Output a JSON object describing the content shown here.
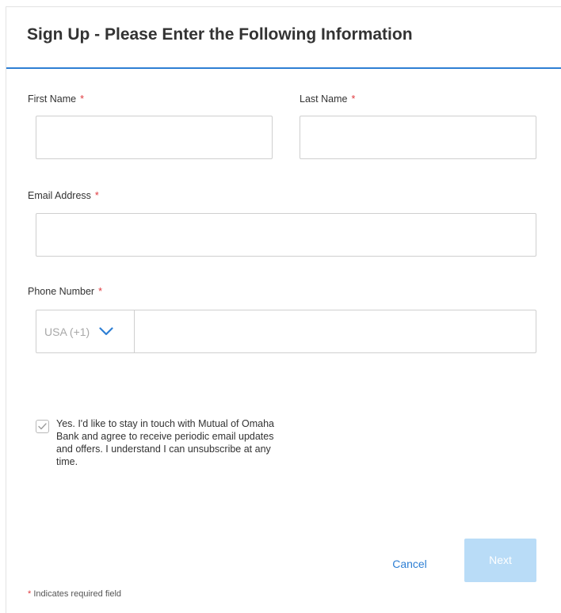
{
  "form": {
    "title": "Sign Up - Please Enter the Following Information",
    "required_marker": "*",
    "first_name": {
      "label": "First Name",
      "value": "",
      "placeholder": ""
    },
    "last_name": {
      "label": "Last Name",
      "value": "",
      "placeholder": ""
    },
    "email": {
      "label": "Email Address",
      "value": "",
      "placeholder": ""
    },
    "phone": {
      "label": "Phone Number",
      "country_code": "USA (+1)",
      "value": "",
      "placeholder": ""
    },
    "consent": {
      "text": "Yes. I'd like to stay in touch with Mutual of Omaha Bank and agree to receive periodic email updates and offers. I understand I can unsubscribe at any time.",
      "checked": false
    },
    "cancel_label": "Cancel",
    "next_label": "Next",
    "footnote": "Indicates required field"
  },
  "icons": {
    "dropdown": "chevron-down-icon",
    "checkbox": "checkmark-icon"
  },
  "colors": {
    "accent": "#2e7fd4",
    "required": "#e0393e",
    "next_disabled": "#b9dcf7",
    "border": "#cfcfcf"
  }
}
